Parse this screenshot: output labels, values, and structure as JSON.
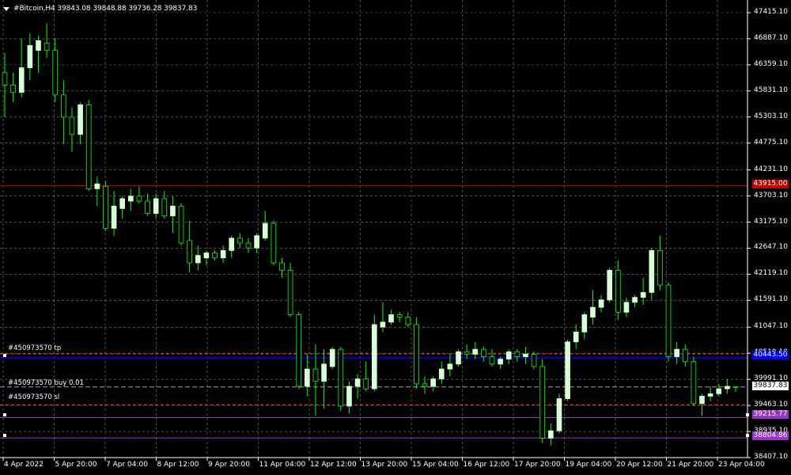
{
  "header": {
    "title": "#Bitcoin,H4  39843.08 39848.88 39736.28 39837.83"
  },
  "colors": {
    "background": "#000000",
    "grid": "#d0d0d0",
    "bull_candle": "#d8ffd8",
    "wick": "#00ff00",
    "axis": "#ffffff",
    "alert_line": "#c00000",
    "tp_line": "#0000ff",
    "sl_line": "#9933cc",
    "order_dash": "#ff3030"
  },
  "y_axis": {
    "labels": [
      "47415.10",
      "46887.10",
      "46359.10",
      "45831.10",
      "45303.10",
      "44775.10",
      "44231.10",
      "43703.10",
      "43175.10",
      "42647.10",
      "42119.10",
      "41591.10",
      "41047.10",
      "40519.10",
      "39991.10",
      "39463.10",
      "38935.10",
      "38407.10"
    ]
  },
  "x_axis": {
    "labels": [
      "4 Apr 2022",
      "5 Apr 20:00",
      "7 Apr 04:00",
      "8 Apr 12:00",
      "9 Apr 20:00",
      "11 Apr 04:00",
      "12 Apr 12:00",
      "13 Apr 20:00",
      "15 Apr 04:00",
      "16 Apr 12:00",
      "17 Apr 20:00",
      "19 Apr 04:00",
      "20 Apr 12:00",
      "21 Apr 20:00",
      "23 Apr 04:00"
    ]
  },
  "price_tags": {
    "alert": "43915.00",
    "tp": "40443.50",
    "current": "39837.83",
    "sl": "39215.77",
    "line": "38804.86"
  },
  "orders": {
    "tp_label": "#450973570 tp",
    "buy_label": "#450973570 buy 0.01",
    "sl_label": "#450973570 sl"
  },
  "chart_data": {
    "type": "candlestick",
    "symbol": "#Bitcoin",
    "timeframe": "H4",
    "ylim": [
      38407.1,
      47415.1
    ],
    "horizontal_lines": [
      {
        "name": "alert",
        "price": 43915.0
      },
      {
        "name": "tp",
        "price": 40443.5
      },
      {
        "name": "current",
        "price": 39837.83
      },
      {
        "name": "sl",
        "price": 39215.77
      },
      {
        "name": "level",
        "price": 38804.86
      }
    ],
    "candles": [
      [
        46200,
        46600,
        45300,
        45950
      ],
      [
        45950,
        46200,
        45600,
        45800
      ],
      [
        45800,
        46900,
        45700,
        46300
      ],
      [
        46300,
        47000,
        46050,
        46750
      ],
      [
        46650,
        46950,
        46200,
        46850
      ],
      [
        46800,
        47200,
        46500,
        46650
      ],
      [
        46650,
        46900,
        45600,
        45750
      ],
      [
        45750,
        46050,
        44750,
        45300
      ],
      [
        45300,
        45500,
        44600,
        44950
      ],
      [
        44950,
        45600,
        44750,
        45550
      ],
      [
        45550,
        45650,
        43800,
        43850
      ],
      [
        43850,
        44100,
        43500,
        43950
      ],
      [
        43900,
        44000,
        43000,
        43050
      ],
      [
        43050,
        43800,
        42900,
        43500
      ],
      [
        43450,
        43700,
        43250,
        43650
      ],
      [
        43600,
        43850,
        43400,
        43700
      ],
      [
        43700,
        43900,
        43550,
        43600
      ],
      [
        43600,
        43750,
        43300,
        43350
      ],
      [
        43350,
        43750,
        43250,
        43650
      ],
      [
        43650,
        43800,
        43250,
        43300
      ],
      [
        43300,
        43700,
        42950,
        43500
      ],
      [
        43500,
        43550,
        42700,
        42750
      ],
      [
        42800,
        43200,
        42150,
        42350
      ],
      [
        42350,
        42700,
        42200,
        42500
      ],
      [
        42450,
        42600,
        42300,
        42550
      ],
      [
        42550,
        42600,
        42400,
        42450
      ],
      [
        42450,
        42700,
        42350,
        42600
      ],
      [
        42600,
        42900,
        42450,
        42850
      ],
      [
        42850,
        42950,
        42650,
        42750
      ],
      [
        42750,
        42850,
        42550,
        42650
      ],
      [
        42650,
        42950,
        42550,
        42900
      ],
      [
        42850,
        43400,
        42800,
        43150
      ],
      [
        43150,
        43200,
        42300,
        42350
      ],
      [
        42350,
        42450,
        42050,
        42200
      ],
      [
        42200,
        42350,
        41250,
        41300
      ],
      [
        41300,
        41350,
        39800,
        39850
      ],
      [
        39850,
        40500,
        39650,
        40200
      ],
      [
        40200,
        40700,
        39250,
        39950
      ],
      [
        39950,
        40600,
        39400,
        40300
      ],
      [
        40250,
        40650,
        40200,
        40600
      ],
      [
        40600,
        40650,
        39350,
        39450
      ],
      [
        39450,
        39950,
        39300,
        39850
      ],
      [
        39850,
        40100,
        39600,
        40000
      ],
      [
        40000,
        40350,
        39750,
        39800
      ],
      [
        39800,
        41300,
        39750,
        41100
      ],
      [
        41050,
        41550,
        40950,
        41150
      ],
      [
        41150,
        41400,
        41100,
        41300
      ],
      [
        41300,
        41350,
        41150,
        41250
      ],
      [
        41250,
        41350,
        41050,
        41100
      ],
      [
        41100,
        41250,
        39800,
        39900
      ],
      [
        39900,
        40050,
        39700,
        39850
      ],
      [
        39850,
        40050,
        39750,
        40000
      ],
      [
        40000,
        40350,
        39900,
        40200
      ],
      [
        40200,
        40500,
        40050,
        40300
      ],
      [
        40300,
        40600,
        40250,
        40550
      ],
      [
        40550,
        40700,
        40400,
        40500
      ],
      [
        40500,
        40750,
        40400,
        40600
      ],
      [
        40600,
        40650,
        40350,
        40450
      ],
      [
        40450,
        40600,
        40250,
        40300
      ],
      [
        40300,
        40450,
        40200,
        40400
      ],
      [
        40400,
        40600,
        40300,
        40550
      ],
      [
        40550,
        40600,
        40350,
        40450
      ],
      [
        40450,
        40650,
        40300,
        40500
      ],
      [
        40500,
        40550,
        40200,
        40250
      ],
      [
        40250,
        40400,
        38700,
        38800
      ],
      [
        38800,
        39100,
        38650,
        38950
      ],
      [
        38950,
        39700,
        38900,
        39600
      ],
      [
        39600,
        40800,
        39550,
        40750
      ],
      [
        40750,
        41100,
        40600,
        40950
      ],
      [
        40950,
        41350,
        40800,
        41300
      ],
      [
        41250,
        41800,
        41100,
        41450
      ],
      [
        41450,
        41700,
        41350,
        41600
      ],
      [
        41600,
        42250,
        41550,
        42200
      ],
      [
        42200,
        42400,
        41200,
        41350
      ],
      [
        41350,
        41650,
        41250,
        41550
      ],
      [
        41550,
        41700,
        41450,
        41650
      ],
      [
        41650,
        42050,
        41500,
        41750
      ],
      [
        41750,
        42650,
        41600,
        42600
      ],
      [
        42600,
        42900,
        41800,
        41900
      ],
      [
        41900,
        41950,
        40350,
        40450
      ],
      [
        40450,
        40750,
        40300,
        40600
      ],
      [
        40600,
        40700,
        40250,
        40350
      ],
      [
        40350,
        40450,
        39450,
        39500
      ],
      [
        39500,
        39700,
        39250,
        39650
      ],
      [
        39650,
        39850,
        39550,
        39700
      ],
      [
        39700,
        39900,
        39650,
        39800
      ],
      [
        39800,
        40000,
        39700,
        39850
      ],
      [
        39843.08,
        39848.88,
        39736.28,
        39837.83
      ]
    ]
  }
}
